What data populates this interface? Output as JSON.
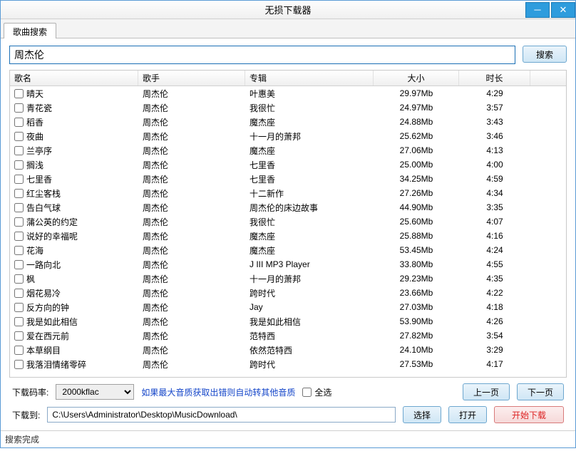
{
  "window": {
    "title": "无损下载器"
  },
  "tabs": [
    {
      "label": "歌曲搜索"
    }
  ],
  "search": {
    "value": "周杰伦",
    "button": "搜索"
  },
  "columns": [
    "歌名",
    "歌手",
    "专辑",
    "大小",
    "时长"
  ],
  "rows": [
    {
      "name": "晴天",
      "artist": "周杰伦",
      "album": "叶惠美",
      "size": "29.97Mb",
      "dur": "4:29"
    },
    {
      "name": "青花瓷",
      "artist": "周杰伦",
      "album": "我很忙",
      "size": "24.97Mb",
      "dur": "3:57"
    },
    {
      "name": "稻香",
      "artist": "周杰伦",
      "album": "魔杰座",
      "size": "24.88Mb",
      "dur": "3:43"
    },
    {
      "name": "夜曲",
      "artist": "周杰伦",
      "album": "十一月的萧邦",
      "size": "25.62Mb",
      "dur": "3:46"
    },
    {
      "name": "兰亭序",
      "artist": "周杰伦",
      "album": "魔杰座",
      "size": "27.06Mb",
      "dur": "4:13"
    },
    {
      "name": "搁浅",
      "artist": "周杰伦",
      "album": "七里香",
      "size": "25.00Mb",
      "dur": "4:00"
    },
    {
      "name": "七里香",
      "artist": "周杰伦",
      "album": "七里香",
      "size": "34.25Mb",
      "dur": "4:59"
    },
    {
      "name": "红尘客栈",
      "artist": "周杰伦",
      "album": "十二新作",
      "size": "27.26Mb",
      "dur": "4:34"
    },
    {
      "name": "告白气球",
      "artist": "周杰伦",
      "album": "周杰伦的床边故事",
      "size": "44.90Mb",
      "dur": "3:35"
    },
    {
      "name": "蒲公英的约定",
      "artist": "周杰伦",
      "album": "我很忙",
      "size": "25.60Mb",
      "dur": "4:07"
    },
    {
      "name": "说好的幸福呢",
      "artist": "周杰伦",
      "album": "魔杰座",
      "size": "25.88Mb",
      "dur": "4:16"
    },
    {
      "name": "花海",
      "artist": "周杰伦",
      "album": "魔杰座",
      "size": "53.45Mb",
      "dur": "4:24"
    },
    {
      "name": "一路向北",
      "artist": "周杰伦",
      "album": "J III MP3 Player",
      "size": "33.80Mb",
      "dur": "4:55"
    },
    {
      "name": "枫",
      "artist": "周杰伦",
      "album": "十一月的萧邦",
      "size": "29.23Mb",
      "dur": "4:35"
    },
    {
      "name": "烟花易冷",
      "artist": "周杰伦",
      "album": "跨时代",
      "size": "23.66Mb",
      "dur": "4:22"
    },
    {
      "name": "反方向的钟",
      "artist": "周杰伦",
      "album": "Jay",
      "size": "27.03Mb",
      "dur": "4:18"
    },
    {
      "name": "我是如此相信",
      "artist": "周杰伦",
      "album": "我是如此相信",
      "size": "53.90Mb",
      "dur": "4:26"
    },
    {
      "name": "爱在西元前",
      "artist": "周杰伦",
      "album": "范特西",
      "size": "27.82Mb",
      "dur": "3:54"
    },
    {
      "name": "本草纲目",
      "artist": "周杰伦",
      "album": "依然范特西",
      "size": "24.10Mb",
      "dur": "3:29"
    },
    {
      "name": "我落泪情绪零碎",
      "artist": "周杰伦",
      "album": "跨时代",
      "size": "27.53Mb",
      "dur": "4:17"
    }
  ],
  "options": {
    "bitrate_label": "下载码率:",
    "bitrate_value": "2000kflac",
    "hint": "如果最大音质获取出错则自动转其他音质",
    "select_all": "全选",
    "prev": "上一页",
    "next": "下一页"
  },
  "download": {
    "path_label": "下载到:",
    "path_value": "C:\\Users\\Administrator\\Desktop\\MusicDownload\\",
    "choose": "选择",
    "open": "打开",
    "start": "开始下载"
  },
  "status": "搜索完成"
}
